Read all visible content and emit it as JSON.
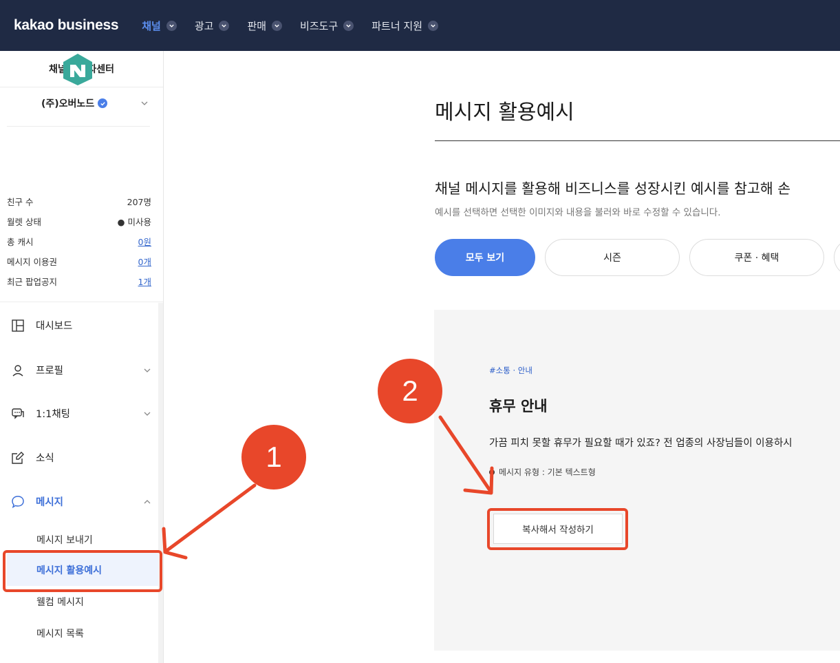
{
  "topnav": {
    "logo": "kakao business",
    "items": [
      {
        "label": "채널",
        "active": true
      },
      {
        "label": "광고",
        "active": false
      },
      {
        "label": "판매",
        "active": false
      },
      {
        "label": "비즈도구",
        "active": false
      },
      {
        "label": "파트너 지원",
        "active": false
      }
    ]
  },
  "sidebar": {
    "title": "채널 관리자센터",
    "company": "(주)오버노드",
    "stats": [
      {
        "label": "친구 수",
        "value": "207명"
      },
      {
        "label": "월렛 상태",
        "value": "● 미사용"
      },
      {
        "label": "총 캐시",
        "value": "0원"
      },
      {
        "label": "메시지 이용권",
        "value": "0개"
      },
      {
        "label": "최근 팝업공지",
        "value": "1개"
      }
    ],
    "menu": [
      {
        "label": "대시보드",
        "icon": "dashboard-icon"
      },
      {
        "label": "프로필",
        "icon": "person-icon"
      },
      {
        "label": "1:1채팅",
        "icon": "chat-icon"
      },
      {
        "label": "소식",
        "icon": "edit-icon"
      },
      {
        "label": "메시지",
        "icon": "message-bubble-icon"
      }
    ],
    "submenu": [
      {
        "label": "메시지 보내기"
      },
      {
        "label": "메시지 활용예시",
        "active": true
      },
      {
        "label": "웰컴 메시지"
      },
      {
        "label": "메시지 목록"
      }
    ]
  },
  "main": {
    "title": "메시지 활용예시",
    "headline": "채널 메시지를 활용해 비즈니스를 성장시킨 예시를 참고해 손",
    "subline": "예시를 선택하면 선택한 이미지와 내용을 불러와 바로 수정할 수 있습니다.",
    "filters": [
      "모두 보기",
      "시즌",
      "쿠폰 · 혜택"
    ],
    "card": {
      "tag": "#소통 · 안내",
      "title": "휴무 안내",
      "desc": "가끔 피치 못할 휴무가 필요할 때가 있죠? 전 업종의 사장님들이 이용하시",
      "type": "메시지 유형 : 기본 텍스트형",
      "button": "복사해서 작성하기"
    }
  },
  "annotations": {
    "badge1": "1",
    "badge2": "2",
    "color": "#e8472a"
  }
}
